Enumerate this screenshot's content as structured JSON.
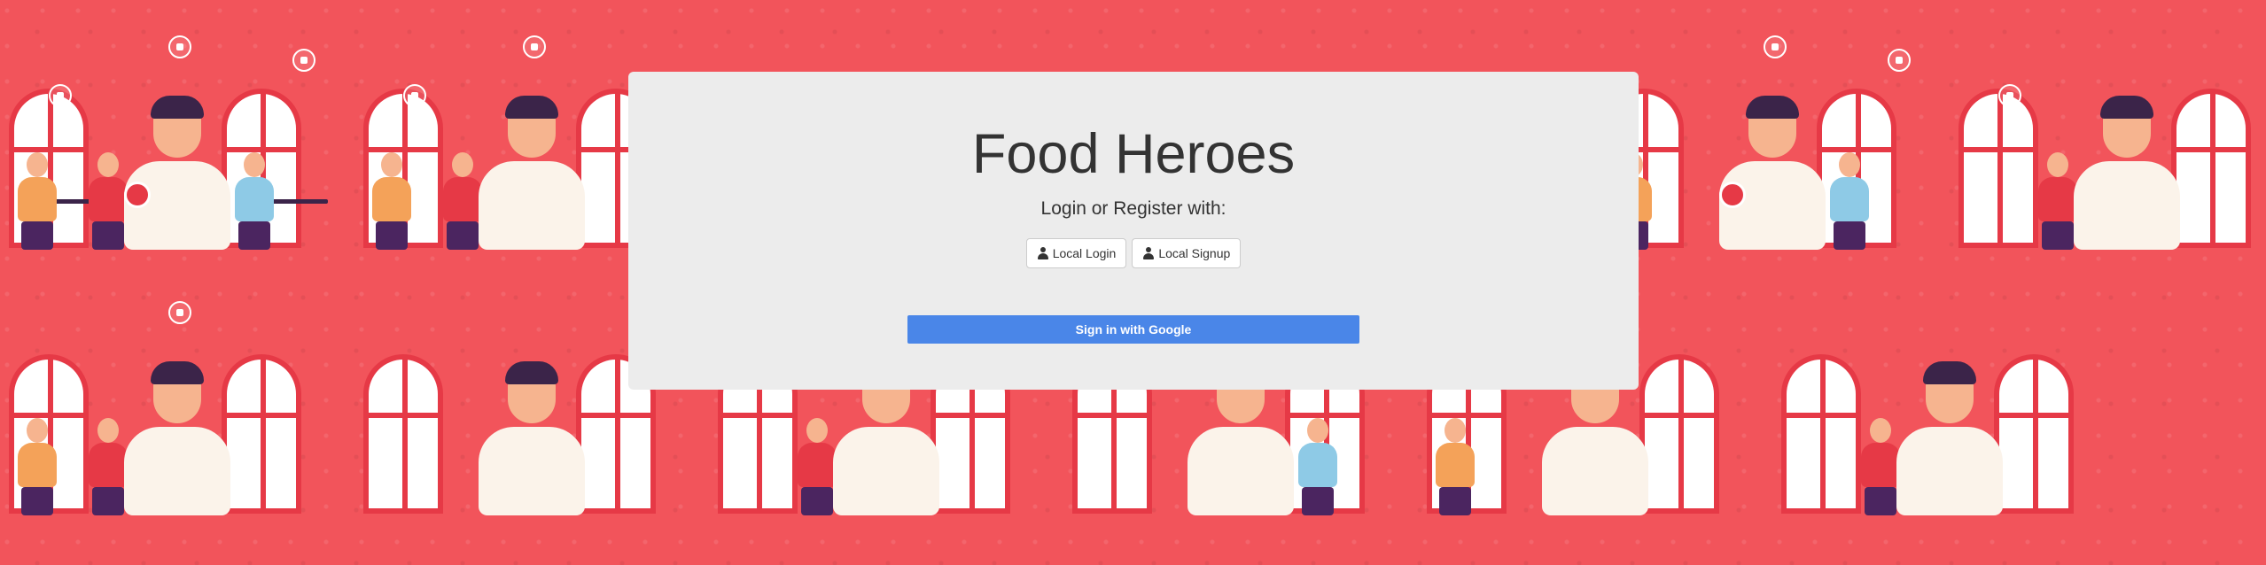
{
  "app": {
    "title": "Food Heroes",
    "subtitle": "Login or Register with:"
  },
  "auth": {
    "local_login_label": "Local Login",
    "local_signup_label": "Local Signup",
    "google_label": "Sign in with Google",
    "user_icon": "user-icon"
  },
  "colors": {
    "background": "#f2545b",
    "card": "#ececec",
    "google_button": "#4a86e8",
    "title_text": "#333333"
  }
}
